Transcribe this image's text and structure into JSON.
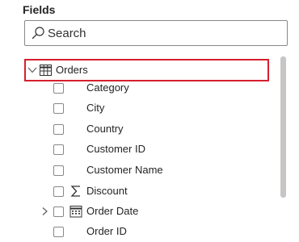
{
  "pane": {
    "title": "Fields"
  },
  "search": {
    "placeholder": "Search",
    "icon": "search-icon"
  },
  "colors": {
    "highlight": "#d5202d",
    "text": "#252423",
    "border": "#8a8886",
    "scrollbar": "#c8c6c4"
  },
  "table": {
    "name": "Orders",
    "expanded": true,
    "icon": "table-icon"
  },
  "fields": [
    {
      "label": "Category",
      "icon": ""
    },
    {
      "label": "City",
      "icon": ""
    },
    {
      "label": "Country",
      "icon": ""
    },
    {
      "label": "Customer ID",
      "icon": ""
    },
    {
      "label": "Customer Name",
      "icon": ""
    },
    {
      "label": "Discount",
      "icon": "sigma-icon"
    },
    {
      "label": "Order Date",
      "icon": "calendar-icon",
      "expandable": true
    },
    {
      "label": "Order ID",
      "icon": ""
    }
  ]
}
